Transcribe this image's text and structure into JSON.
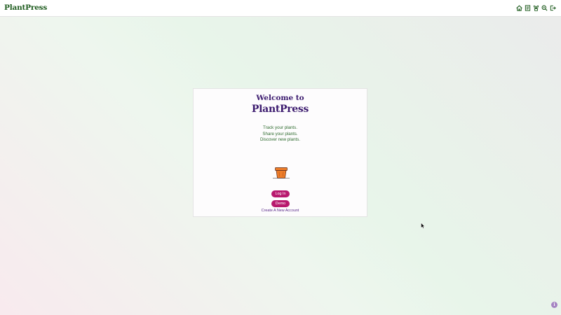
{
  "header": {
    "brand": "PlantPress",
    "nav_icons": [
      "home-icon",
      "notebook-icon",
      "plant-icon",
      "search-icon",
      "logout-icon"
    ]
  },
  "card": {
    "welcome": "Welcome to",
    "title": "PlantPress",
    "taglines": [
      "Track your plants.",
      "Share your plants.",
      "Discover new plants."
    ],
    "login_label": "Log In",
    "demo_label": "Demo",
    "create_account_label": "Create A New Account"
  },
  "info_button": {
    "icon": "info-icon"
  },
  "colors": {
    "brand_green": "#1f5c1f",
    "title_purple": "#3b1a6e",
    "button_magenta": "#b8196e",
    "tagline_green": "#2e6b2e",
    "link_purple": "#5a2a8a"
  }
}
